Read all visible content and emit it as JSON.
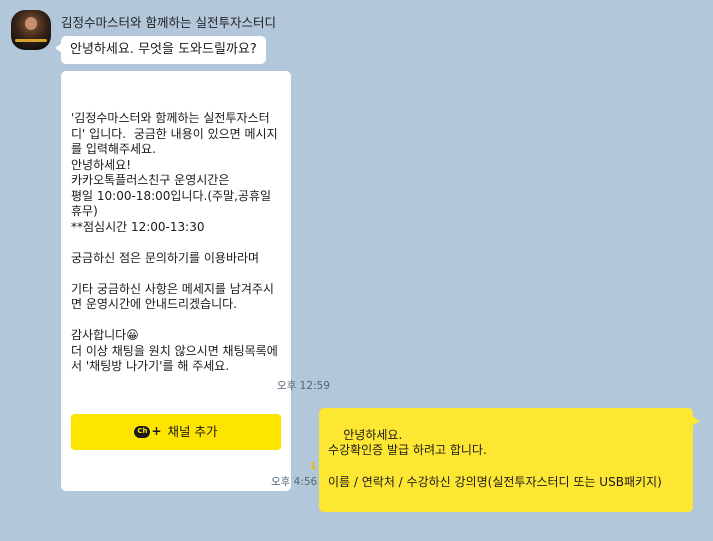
{
  "sender": {
    "name": "김정수마스터와 함께하는 실전투자스터디"
  },
  "messages": {
    "greeting": "안녕하세요. 무엇을 도와드릴까요?",
    "card_text": "'김정수마스터와 함께하는 실전투자스터디' 입니다.  궁금한 내용이 있으면 메시지를 입력해주세요.\n안녕하세요!\n카카오톡플러스친구 운영시간은\n평일 10:00-18:00입니다.(주말,공휴일 휴무)\n**점심시간 12:00-13:30\n\n궁금하신 점은 문의하기를 이용바라며\n\n기타 궁금하신 사항은 메세지를 남겨주시면 운영시간에 안내드리겠습니다.\n\n감사합니다😀\n더 이상 채팅을 원치 않으시면 채팅목록에서 '채팅방 나가기'를 해 주세요.",
    "channel_button_label": "채널 추가",
    "channel_icon_text": "Ch",
    "card_time": "오후 12:59",
    "my_message": "안녕하세요.\n수강확인증 발급 하려고 합니다.\n\n이름 / 연락처 / 수강하신 강의명(실전투자스터디 또는 USB패키지)",
    "my_time": "오후 4:56",
    "unread_count": "1"
  },
  "colors": {
    "background": "#b2c7d9",
    "my_bubble": "#fee733",
    "channel_button": "#fee500",
    "other_bubble": "#ffffff"
  },
  "icons": {
    "avatar": "profile-avatar",
    "channel": "kakao-channel-icon"
  }
}
